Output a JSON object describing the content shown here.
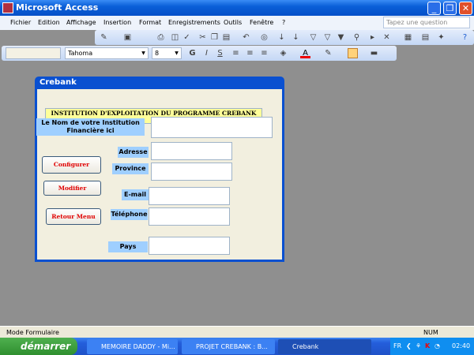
{
  "app": {
    "title": "Microsoft Access"
  },
  "menu": [
    "Fichier",
    "Edition",
    "Affichage",
    "Insertion",
    "Format",
    "Enregistrements",
    "Outils",
    "Fenêtre",
    "?"
  ],
  "help_placeholder": "Tapez une question",
  "format_toolbar": {
    "object": "",
    "font": "Tahoma",
    "size": "8",
    "bold": "G",
    "italic": "I",
    "underline": "S"
  },
  "form": {
    "title": "Crebank",
    "heading": "INSTITUTION D'EXPLOITATION DU PROGRAMME CREBANK",
    "labels": {
      "nom": "Le Nom de votre Institution Financière ici",
      "adresse": "Adresse",
      "province": "Province",
      "email": "E-mail",
      "telephone": "Téléphone",
      "pays": "Pays"
    },
    "buttons": {
      "configurer": "Configurer",
      "modifier": "Modifier",
      "retour": "Retour Menu"
    }
  },
  "status": {
    "mode": "Mode Formulaire",
    "num": "NUM"
  },
  "taskbar": {
    "start": "démarrer",
    "tasks": [
      "MEMOIRE DADDY - Mi...",
      "PROJET CREBANK : B...",
      "Crebank"
    ],
    "lang": "FR",
    "clock": "02:40"
  }
}
